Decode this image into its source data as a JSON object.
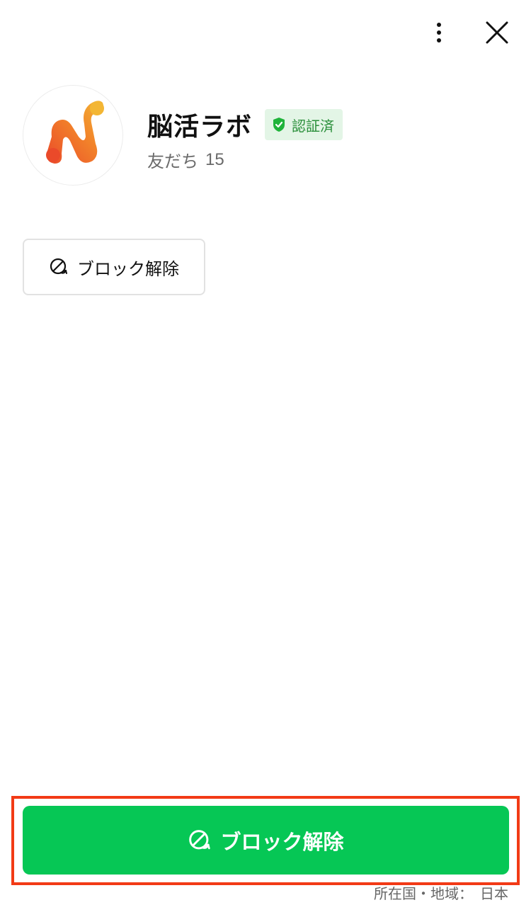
{
  "top_bar": {
    "more_icon": "vertical-ellipsis-icon",
    "close_icon": "close-x-icon"
  },
  "profile": {
    "name": "脳活ラボ",
    "verified_label": "認証済",
    "friends_label": "友だち",
    "friends_count": "15",
    "badge_color": "#2a8f3a",
    "badge_bg": "#e3f5e6"
  },
  "actions": {
    "unblock_small_label": "ブロック解除",
    "unblock_primary_label": "ブロック解除",
    "unblock_icon": "unblock-icon",
    "primary_color": "#06c755"
  },
  "footer": {
    "region_label": "所在国・地域：",
    "region_value": "日本"
  },
  "annotation": {
    "highlight_color": "#f23a16"
  }
}
